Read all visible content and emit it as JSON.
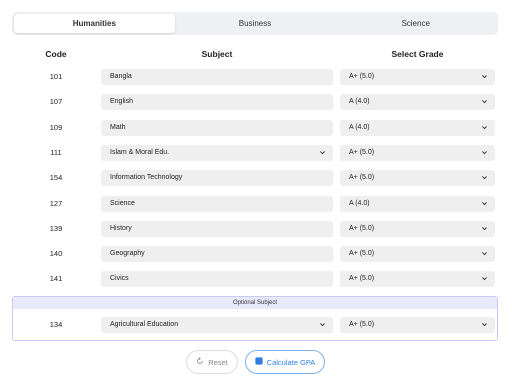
{
  "tabs": [
    {
      "label": "Humanities",
      "active": true
    },
    {
      "label": "Business",
      "active": false
    },
    {
      "label": "Science",
      "active": false
    }
  ],
  "headers": {
    "code": "Code",
    "subject": "Subject",
    "grade": "Select Grade"
  },
  "subjects": [
    {
      "code": "101",
      "subject": "Bangla",
      "subject_has_dropdown": false,
      "grade": "A+ (5.0)"
    },
    {
      "code": "107",
      "subject": "English",
      "subject_has_dropdown": false,
      "grade": "A (4.0)"
    },
    {
      "code": "109",
      "subject": "Math",
      "subject_has_dropdown": false,
      "grade": "A (4.0)"
    },
    {
      "code": "111",
      "subject": "Islam & Moral Edu.",
      "subject_has_dropdown": true,
      "grade": "A+ (5.0)"
    },
    {
      "code": "154",
      "subject": "Information Technology",
      "subject_has_dropdown": false,
      "grade": "A+ (5.0)"
    },
    {
      "code": "127",
      "subject": "Science",
      "subject_has_dropdown": false,
      "grade": "A (4.0)"
    },
    {
      "code": "139",
      "subject": "History",
      "subject_has_dropdown": false,
      "grade": "A+ (5.0)"
    },
    {
      "code": "140",
      "subject": "Geography",
      "subject_has_dropdown": false,
      "grade": "A+ (5.0)"
    },
    {
      "code": "141",
      "subject": "Civics",
      "subject_has_dropdown": false,
      "grade": "A+ (5.0)"
    }
  ],
  "optional": {
    "heading": "Optional Subject",
    "code": "134",
    "subject": "Agricultural Education",
    "grade": "A+ (5.0)"
  },
  "buttons": {
    "reset": "Reset",
    "calculate": "Calculate GPA"
  },
  "colors": {
    "accent": "#2f7fe0",
    "optional_bg": "#e8e9fb",
    "field_bg": "#efefef"
  }
}
